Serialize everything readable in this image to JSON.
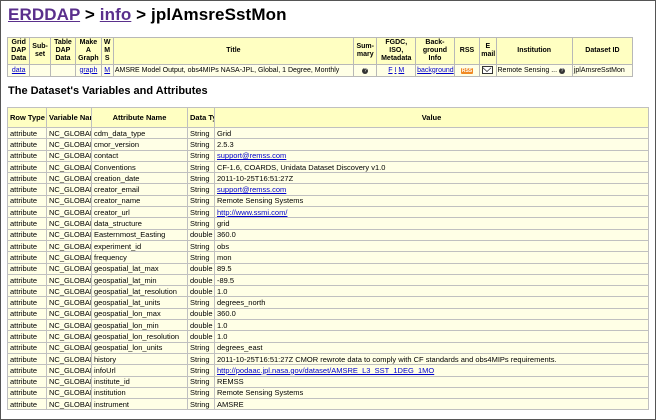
{
  "breadcrumb": {
    "erddap": "ERDDAP",
    "sep1": ">",
    "info": "info",
    "sep2": ">",
    "dataset": "jplAmsreSstMon"
  },
  "info_table": {
    "headers": {
      "griddap": "Grid DAP Data",
      "subset": "Sub-set",
      "tabledap": "Table DAP Data",
      "make_graph": "Make A Graph",
      "wms": "W M S",
      "title": "Title",
      "summary": "Sum-mary",
      "fgdc": "FGDC, ISO, Metadata",
      "background": "Back-ground Info",
      "rss": "RSS",
      "email": "E mail",
      "institution": "Institution",
      "dataset_id": "Dataset ID"
    },
    "row": {
      "griddap": "data",
      "subset": "",
      "tabledap": "",
      "make_graph": "graph",
      "wms": "M",
      "title": "AMSRE Model Output, obs4MIPs NASA-JPL, Global, 1 Degree, Monthly",
      "summary_icon": "?",
      "fgdc_f": "F",
      "fgdc_i": "I",
      "fgdc_m": "M",
      "background": "background",
      "rss": "RSS",
      "institution": "Remote Sensing ...",
      "institution_icon": "?",
      "dataset_id": "jplAmsreSstMon"
    }
  },
  "section_title": "The Dataset's Variables and Attributes",
  "vars_table": {
    "headers": {
      "row_type": "Row Type",
      "variable_name": "Variable Name",
      "attribute_name": "Attribute Name",
      "data_type": "Data Type",
      "value": "Value"
    },
    "rows": [
      {
        "row_type": "attribute",
        "variable_name": "NC_GLOBAL",
        "attribute_name": "cdm_data_type",
        "data_type": "String",
        "value": "Grid",
        "link": false
      },
      {
        "row_type": "attribute",
        "variable_name": "NC_GLOBAL",
        "attribute_name": "cmor_version",
        "data_type": "String",
        "value": "2.5.3",
        "link": false
      },
      {
        "row_type": "attribute",
        "variable_name": "NC_GLOBAL",
        "attribute_name": "contact",
        "data_type": "String",
        "value": "support@remss.com",
        "link": true
      },
      {
        "row_type": "attribute",
        "variable_name": "NC_GLOBAL",
        "attribute_name": "Conventions",
        "data_type": "String",
        "value": "CF-1.6, COARDS, Unidata Dataset Discovery v1.0",
        "link": false
      },
      {
        "row_type": "attribute",
        "variable_name": "NC_GLOBAL",
        "attribute_name": "creation_date",
        "data_type": "String",
        "value": "2011-10-25T16:51:27Z",
        "link": false
      },
      {
        "row_type": "attribute",
        "variable_name": "NC_GLOBAL",
        "attribute_name": "creator_email",
        "data_type": "String",
        "value": "support@remss.com",
        "link": true
      },
      {
        "row_type": "attribute",
        "variable_name": "NC_GLOBAL",
        "attribute_name": "creator_name",
        "data_type": "String",
        "value": "Remote Sensing Systems",
        "link": false
      },
      {
        "row_type": "attribute",
        "variable_name": "NC_GLOBAL",
        "attribute_name": "creator_url",
        "data_type": "String",
        "value": "http://www.ssmi.com/",
        "link": true
      },
      {
        "row_type": "attribute",
        "variable_name": "NC_GLOBAL",
        "attribute_name": "data_structure",
        "data_type": "String",
        "value": "grid",
        "link": false
      },
      {
        "row_type": "attribute",
        "variable_name": "NC_GLOBAL",
        "attribute_name": "Easternmost_Easting",
        "data_type": "double",
        "value": "360.0",
        "link": false
      },
      {
        "row_type": "attribute",
        "variable_name": "NC_GLOBAL",
        "attribute_name": "experiment_id",
        "data_type": "String",
        "value": "obs",
        "link": false
      },
      {
        "row_type": "attribute",
        "variable_name": "NC_GLOBAL",
        "attribute_name": "frequency",
        "data_type": "String",
        "value": "mon",
        "link": false
      },
      {
        "row_type": "attribute",
        "variable_name": "NC_GLOBAL",
        "attribute_name": "geospatial_lat_max",
        "data_type": "double",
        "value": "89.5",
        "link": false
      },
      {
        "row_type": "attribute",
        "variable_name": "NC_GLOBAL",
        "attribute_name": "geospatial_lat_min",
        "data_type": "double",
        "value": "-89.5",
        "link": false
      },
      {
        "row_type": "attribute",
        "variable_name": "NC_GLOBAL",
        "attribute_name": "geospatial_lat_resolution",
        "data_type": "double",
        "value": "1.0",
        "link": false
      },
      {
        "row_type": "attribute",
        "variable_name": "NC_GLOBAL",
        "attribute_name": "geospatial_lat_units",
        "data_type": "String",
        "value": "degrees_north",
        "link": false
      },
      {
        "row_type": "attribute",
        "variable_name": "NC_GLOBAL",
        "attribute_name": "geospatial_lon_max",
        "data_type": "double",
        "value": "360.0",
        "link": false
      },
      {
        "row_type": "attribute",
        "variable_name": "NC_GLOBAL",
        "attribute_name": "geospatial_lon_min",
        "data_type": "double",
        "value": "1.0",
        "link": false
      },
      {
        "row_type": "attribute",
        "variable_name": "NC_GLOBAL",
        "attribute_name": "geospatial_lon_resolution",
        "data_type": "double",
        "value": "1.0",
        "link": false
      },
      {
        "row_type": "attribute",
        "variable_name": "NC_GLOBAL",
        "attribute_name": "geospatial_lon_units",
        "data_type": "String",
        "value": "degrees_east",
        "link": false
      },
      {
        "row_type": "attribute",
        "variable_name": "NC_GLOBAL",
        "attribute_name": "history",
        "data_type": "String",
        "value": "2011-10-25T16:51:27Z CMOR rewrote data to comply with CF standards and obs4MIPs requirements.",
        "link": false
      },
      {
        "row_type": "attribute",
        "variable_name": "NC_GLOBAL",
        "attribute_name": "infoUrl",
        "data_type": "String",
        "value": "http://podaac.jpl.nasa.gov/dataset/AMSRE_L3_SST_1DEG_1MO",
        "link": true
      },
      {
        "row_type": "attribute",
        "variable_name": "NC_GLOBAL",
        "attribute_name": "institute_id",
        "data_type": "String",
        "value": "REMSS",
        "link": false
      },
      {
        "row_type": "attribute",
        "variable_name": "NC_GLOBAL",
        "attribute_name": "institution",
        "data_type": "String",
        "value": "Remote Sensing Systems",
        "link": false
      },
      {
        "row_type": "attribute",
        "variable_name": "NC_GLOBAL",
        "attribute_name": "instrument",
        "data_type": "String",
        "value": "AMSRE",
        "link": false
      }
    ]
  },
  "colors": {
    "header_bg": "#ffffc2",
    "cell_bg": "#ffffe6",
    "link": "#0000cc",
    "breadcrumb_link": "#5a2f8c",
    "rss_badge": "#f08a24"
  }
}
